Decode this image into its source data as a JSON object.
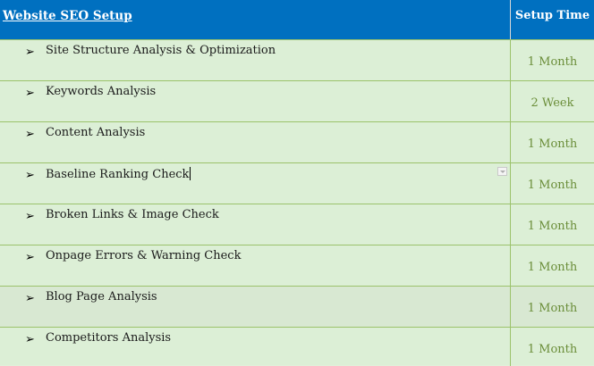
{
  "header": {
    "title": "Website SEO Setup",
    "time_column": "Setup Time"
  },
  "rows": [
    {
      "bullet": "➢",
      "task": "Site Structure Analysis & Optimization",
      "time": "1 Month"
    },
    {
      "bullet": "➢",
      "task": "Keywords Analysis",
      "time": "2 Week"
    },
    {
      "bullet": "➢",
      "task": "Content Analysis",
      "time": "1 Month"
    },
    {
      "bullet": "➢",
      "task": "Baseline Ranking Check",
      "time": "1 Month"
    },
    {
      "bullet": "➢",
      "task": "Broken Links & Image Check",
      "time": "1 Month"
    },
    {
      "bullet": "➢",
      "task": "Onpage Errors & Warning Check",
      "time": "1 Month"
    },
    {
      "bullet": "➢",
      "task": "Blog Page Analysis",
      "time": "1 Month"
    },
    {
      "bullet": "➢",
      "task": "Competitors Analysis",
      "time": "1 Month"
    }
  ],
  "colors": {
    "header_bg": "#0070c0",
    "row_bg": "#e2efda",
    "grid_line": "#9bc26b",
    "time_text": "#6b8e3a"
  },
  "icons": {
    "bullet": "arrowhead-bullet-icon",
    "dropdown": "dropdown-arrow-icon"
  }
}
